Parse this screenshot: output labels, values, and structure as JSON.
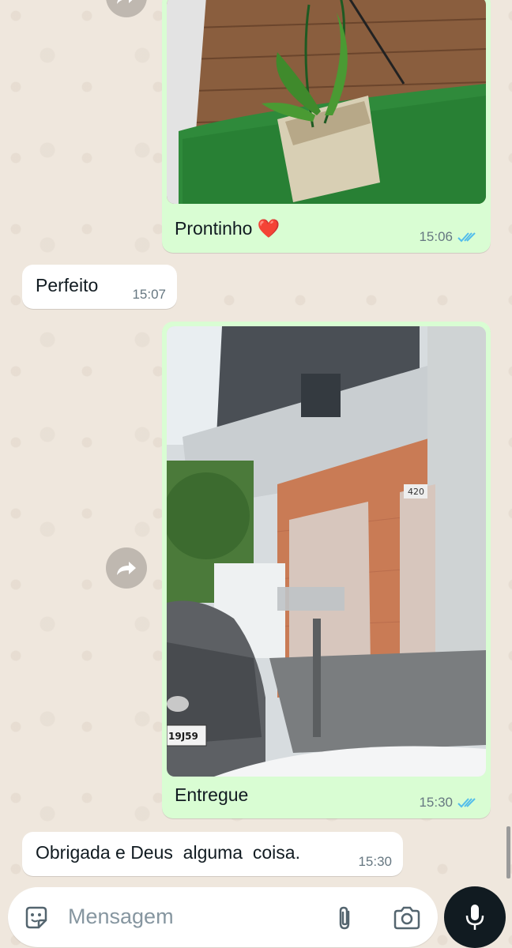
{
  "messages": [
    {
      "type": "image",
      "direction": "outgoing",
      "caption": "Prontinho",
      "emoji": "❤️",
      "time": "15:06",
      "status": "read",
      "image_subject": "potted orchid on artificial grass against wooden wall"
    },
    {
      "type": "text",
      "direction": "incoming",
      "text": "Perfeito",
      "time": "15:07"
    },
    {
      "type": "image",
      "direction": "outgoing",
      "caption": "Entregue",
      "time": "15:30",
      "status": "read",
      "image_subject": "two-story house with brick facade, gray car parked in front",
      "house_number": "420",
      "plate": "19J59"
    },
    {
      "type": "text",
      "direction": "incoming",
      "text": "Obrigada e Deus  alguma  coisa.",
      "time": "15:30"
    }
  ],
  "composer": {
    "placeholder": "Mensagem",
    "icons": [
      "sticker-icon",
      "attach-icon",
      "camera-icon",
      "mic-icon"
    ]
  },
  "colors": {
    "outgoing_bubble": "#d9fdd3",
    "incoming_bubble": "#ffffff",
    "wallpaper": "#efe7dd",
    "read_ticks": "#53bdeb",
    "mic_button": "#111b21"
  }
}
